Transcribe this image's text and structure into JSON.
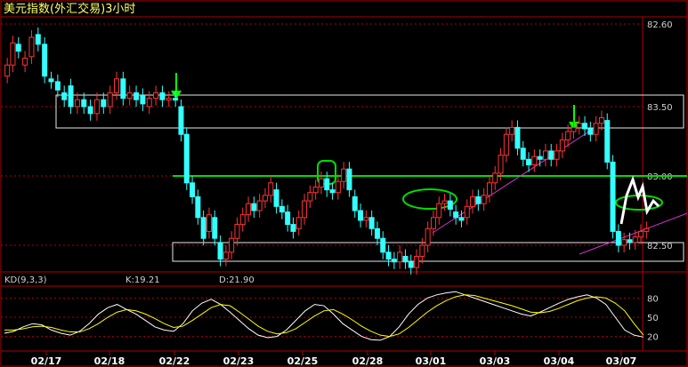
{
  "chart_data": {
    "title": "美元指数(外汇交易)3小时",
    "type": "candlestick",
    "price_axis": {
      "ticks": [
        {
          "label": "82.60",
          "value": 86.1
        },
        {
          "label": "83.50",
          "value": 83.5
        },
        {
          "label": "83.00",
          "value": 83.0
        },
        {
          "label": "82.50",
          "value": 82.5
        }
      ]
    },
    "x_ticks": [
      "02/17",
      "02/18",
      "02/22",
      "02/23",
      "02/25",
      "02/28",
      "03/01",
      "03/03",
      "03/04",
      "03/07"
    ],
    "candles": [
      {
        "x": 0.3,
        "o": 83.72,
        "c": 83.8
      },
      {
        "x": 0.9,
        "o": 83.8,
        "c": 83.96
      },
      {
        "x": 1.5,
        "o": 83.95,
        "c": 83.9
      },
      {
        "x": 2.2,
        "o": 83.8,
        "c": 83.85
      },
      {
        "x": 2.9,
        "o": 83.86,
        "c": 84.0
      },
      {
        "x": 3.6,
        "o": 84.02,
        "c": 83.95
      },
      {
        "x": 4.3,
        "o": 83.95,
        "c": 83.72
      },
      {
        "x": 5.0,
        "o": 83.7,
        "c": 83.68
      },
      {
        "x": 5.7,
        "o": 83.68,
        "c": 83.62
      },
      {
        "x": 6.4,
        "o": 83.6,
        "c": 83.55
      },
      {
        "x": 7.1,
        "o": 83.65,
        "c": 83.5
      },
      {
        "x": 7.8,
        "o": 83.5,
        "c": 83.55
      },
      {
        "x": 8.5,
        "o": 83.55,
        "c": 83.5
      },
      {
        "x": 9.2,
        "o": 83.5,
        "c": 83.45
      },
      {
        "x": 9.9,
        "o": 83.45,
        "c": 83.55
      },
      {
        "x": 10.6,
        "o": 83.55,
        "c": 83.5
      },
      {
        "x": 11.3,
        "o": 83.5,
        "c": 83.6
      },
      {
        "x": 12.0,
        "o": 83.6,
        "c": 83.7
      },
      {
        "x": 12.7,
        "o": 83.7,
        "c": 83.56
      },
      {
        "x": 13.4,
        "o": 83.56,
        "c": 83.6
      },
      {
        "x": 14.1,
        "o": 83.6,
        "c": 83.55
      },
      {
        "x": 14.8,
        "o": 83.58,
        "c": 83.52
      },
      {
        "x": 15.5,
        "o": 83.5,
        "c": 83.56
      },
      {
        "x": 16.2,
        "o": 83.56,
        "c": 83.6
      },
      {
        "x": 16.9,
        "o": 83.6,
        "c": 83.55
      },
      {
        "x": 17.6,
        "o": 83.55,
        "c": 83.56
      },
      {
        "x": 18.3,
        "o": 83.56,
        "c": 83.55
      },
      {
        "x": 18.9,
        "o": 83.5,
        "c": 83.3
      },
      {
        "x": 19.5,
        "o": 83.3,
        "c": 82.95
      },
      {
        "x": 20.1,
        "o": 82.95,
        "c": 82.85
      },
      {
        "x": 20.7,
        "o": 82.85,
        "c": 82.7
      },
      {
        "x": 21.3,
        "o": 82.7,
        "c": 82.55
      },
      {
        "x": 21.9,
        "o": 82.6,
        "c": 82.72
      },
      {
        "x": 22.5,
        "o": 82.7,
        "c": 82.55
      },
      {
        "x": 23.1,
        "o": 82.52,
        "c": 82.4
      },
      {
        "x": 23.7,
        "o": 82.4,
        "c": 82.45
      },
      {
        "x": 24.3,
        "o": 82.45,
        "c": 82.55
      },
      {
        "x": 24.9,
        "o": 82.55,
        "c": 82.65
      },
      {
        "x": 25.5,
        "o": 82.65,
        "c": 82.72
      },
      {
        "x": 26.1,
        "o": 82.72,
        "c": 82.8
      },
      {
        "x": 26.7,
        "o": 82.8,
        "c": 82.75
      },
      {
        "x": 27.3,
        "o": 82.75,
        "c": 82.82
      },
      {
        "x": 27.9,
        "o": 82.82,
        "c": 82.86
      },
      {
        "x": 28.5,
        "o": 82.86,
        "c": 82.95
      },
      {
        "x": 29.1,
        "o": 82.9,
        "c": 82.78
      },
      {
        "x": 29.7,
        "o": 82.78,
        "c": 82.74
      },
      {
        "x": 30.3,
        "o": 82.74,
        "c": 82.65
      },
      {
        "x": 30.9,
        "o": 82.65,
        "c": 82.6
      },
      {
        "x": 31.5,
        "o": 82.62,
        "c": 82.7
      },
      {
        "x": 32.1,
        "o": 82.7,
        "c": 82.82
      },
      {
        "x": 32.7,
        "o": 82.82,
        "c": 82.88
      },
      {
        "x": 33.3,
        "o": 82.88,
        "c": 82.92
      },
      {
        "x": 33.9,
        "o": 82.92,
        "c": 82.98
      },
      {
        "x": 34.5,
        "o": 82.98,
        "c": 82.9
      },
      {
        "x": 35.1,
        "o": 82.9,
        "c": 82.88
      },
      {
        "x": 35.7,
        "o": 82.88,
        "c": 82.96
      },
      {
        "x": 36.3,
        "o": 82.96,
        "c": 83.05
      },
      {
        "x": 36.9,
        "o": 83.05,
        "c": 82.9
      },
      {
        "x": 37.5,
        "o": 82.85,
        "c": 82.75
      },
      {
        "x": 38.1,
        "o": 82.75,
        "c": 82.68
      },
      {
        "x": 38.7,
        "o": 82.68,
        "c": 82.7
      },
      {
        "x": 39.3,
        "o": 82.7,
        "c": 82.62
      },
      {
        "x": 39.9,
        "o": 82.62,
        "c": 82.55
      },
      {
        "x": 40.5,
        "o": 82.55,
        "c": 82.45
      },
      {
        "x": 41.1,
        "o": 82.45,
        "c": 82.4
      },
      {
        "x": 41.7,
        "o": 82.4,
        "c": 82.38
      },
      {
        "x": 42.3,
        "o": 82.38,
        "c": 82.45
      },
      {
        "x": 42.9,
        "o": 82.42,
        "c": 82.38
      },
      {
        "x": 43.5,
        "o": 82.38,
        "c": 82.34
      },
      {
        "x": 44.1,
        "o": 82.34,
        "c": 82.42
      },
      {
        "x": 44.7,
        "o": 82.42,
        "c": 82.5
      },
      {
        "x": 45.3,
        "o": 82.5,
        "c": 82.62
      },
      {
        "x": 45.9,
        "o": 82.62,
        "c": 82.7
      },
      {
        "x": 46.5,
        "o": 82.7,
        "c": 82.8
      },
      {
        "x": 47.1,
        "o": 82.8,
        "c": 82.82
      },
      {
        "x": 47.7,
        "o": 82.82,
        "c": 82.76
      },
      {
        "x": 48.3,
        "o": 82.74,
        "c": 82.7
      },
      {
        "x": 48.9,
        "o": 82.7,
        "c": 82.68
      },
      {
        "x": 49.5,
        "o": 82.7,
        "c": 82.78
      },
      {
        "x": 50.1,
        "o": 82.78,
        "c": 82.85
      },
      {
        "x": 50.7,
        "o": 82.85,
        "c": 82.8
      },
      {
        "x": 51.3,
        "o": 82.8,
        "c": 82.86
      },
      {
        "x": 51.9,
        "o": 82.86,
        "c": 82.95
      },
      {
        "x": 52.5,
        "o": 82.95,
        "c": 83.02
      },
      {
        "x": 53.1,
        "o": 83.02,
        "c": 83.15
      },
      {
        "x": 53.7,
        "o": 83.15,
        "c": 83.3
      },
      {
        "x": 54.3,
        "o": 83.3,
        "c": 83.35
      },
      {
        "x": 54.9,
        "o": 83.35,
        "c": 83.2
      },
      {
        "x": 55.5,
        "o": 83.2,
        "c": 83.12
      },
      {
        "x": 56.1,
        "o": 83.12,
        "c": 83.08
      },
      {
        "x": 56.7,
        "o": 83.08,
        "c": 83.14
      },
      {
        "x": 57.3,
        "o": 83.14,
        "c": 83.12
      },
      {
        "x": 57.9,
        "o": 83.12,
        "c": 83.18
      },
      {
        "x": 58.5,
        "o": 83.18,
        "c": 83.12
      },
      {
        "x": 59.1,
        "o": 83.12,
        "c": 83.18
      },
      {
        "x": 59.7,
        "o": 83.18,
        "c": 83.26
      },
      {
        "x": 60.3,
        "o": 83.26,
        "c": 83.32
      },
      {
        "x": 60.9,
        "o": 83.32,
        "c": 83.35
      },
      {
        "x": 61.5,
        "o": 83.35,
        "c": 83.38
      },
      {
        "x": 62.1,
        "o": 83.38,
        "c": 83.34
      },
      {
        "x": 62.7,
        "o": 83.34,
        "c": 83.3
      },
      {
        "x": 63.3,
        "o": 83.3,
        "c": 83.38
      },
      {
        "x": 63.9,
        "o": 83.38,
        "c": 83.42
      },
      {
        "x": 64.5,
        "o": 83.4,
        "c": 83.1
      },
      {
        "x": 65.1,
        "o": 83.1,
        "c": 82.6
      },
      {
        "x": 65.7,
        "o": 82.6,
        "c": 82.5
      },
      {
        "x": 66.3,
        "o": 82.5,
        "c": 82.54
      },
      {
        "x": 66.9,
        "o": 82.54,
        "c": 82.52
      },
      {
        "x": 67.5,
        "o": 82.52,
        "c": 82.56
      },
      {
        "x": 68.1,
        "o": 82.56,
        "c": 82.6
      },
      {
        "x": 68.7,
        "o": 82.6,
        "c": 82.62
      }
    ],
    "indicator": {
      "name": "KD(9,3,3)",
      "k_label": "K:19.21",
      "d_label": "D:21.90",
      "ticks": [
        "80",
        "50",
        "20"
      ],
      "k": [
        25,
        28,
        35,
        40,
        38,
        30,
        25,
        22,
        28,
        40,
        55,
        65,
        70,
        62,
        55,
        45,
        35,
        30,
        28,
        40,
        60,
        72,
        78,
        70,
        58,
        45,
        32,
        22,
        18,
        20,
        30,
        45,
        60,
        70,
        68,
        55,
        40,
        30,
        20,
        15,
        14,
        20,
        35,
        55,
        70,
        80,
        85,
        88,
        90,
        85,
        80,
        75,
        70,
        65,
        60,
        55,
        52,
        58,
        65,
        72,
        78,
        82,
        85,
        80,
        70,
        50,
        30,
        22,
        19
      ],
      "d": [
        30,
        30,
        32,
        35,
        36,
        34,
        30,
        27,
        27,
        32,
        40,
        50,
        58,
        62,
        60,
        55,
        48,
        40,
        34,
        36,
        45,
        55,
        65,
        70,
        68,
        58,
        47,
        36,
        28,
        24,
        26,
        32,
        42,
        52,
        60,
        62,
        55,
        46,
        36,
        28,
        22,
        20,
        24,
        34,
        46,
        58,
        68,
        76,
        82,
        85,
        84,
        80,
        76,
        72,
        68,
        63,
        58,
        57,
        59,
        64,
        70,
        76,
        80,
        82,
        80,
        72,
        60,
        40,
        22
      ]
    }
  }
}
